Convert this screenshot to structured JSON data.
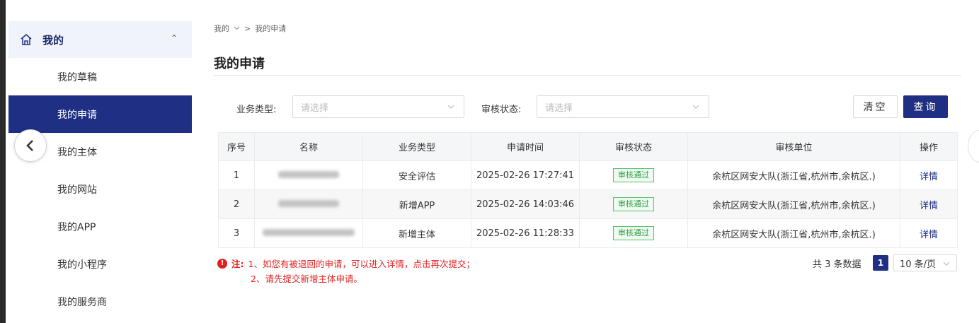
{
  "sidebar": {
    "header": "我的",
    "items": [
      {
        "label": "我的草稿"
      },
      {
        "label": "我的申请"
      },
      {
        "label": "我的主体"
      },
      {
        "label": "我的网站"
      },
      {
        "label": "我的APP"
      },
      {
        "label": "我的小程序"
      },
      {
        "label": "我的服务商"
      }
    ],
    "active_index": 1
  },
  "breadcrumb": {
    "root": "我的",
    "current": "我的申请"
  },
  "page_title": "我的申请",
  "filters": {
    "business_type_label": "业务类型:",
    "business_type_placeholder": "请选择",
    "review_status_label": "审核状态:",
    "review_status_placeholder": "请选择",
    "clear_label": "清空",
    "query_label": "查询"
  },
  "table": {
    "columns": [
      "序号",
      "名称",
      "业务类型",
      "申请时间",
      "审核状态",
      "审核单位",
      "操作"
    ],
    "rows": [
      {
        "index": "1",
        "name": "",
        "type": "安全评估",
        "time": "2025-02-26 17:27:41",
        "status": "审核通过",
        "unit": "余杭区网安大队(浙江省,杭州市,余杭区.)",
        "action": "详情"
      },
      {
        "index": "2",
        "name": "",
        "type": "新增APP",
        "time": "2025-02-26 14:03:46",
        "status": "审核通过",
        "unit": "余杭区网安大队(浙江省,杭州市,余杭区.)",
        "action": "详情"
      },
      {
        "index": "3",
        "name": "",
        "type": "新增主体",
        "time": "2025-02-26 11:28:33",
        "status": "审核通过",
        "unit": "余杭区网安大队(浙江省,杭州市,余杭区.)",
        "action": "详情"
      }
    ]
  },
  "notes": {
    "prefix": "注:",
    "line1": "1、如您有被退回的申请，可以进入详情，点击再次提交；",
    "line2": "2、请先提交新增主体申请。"
  },
  "pagination": {
    "total_text": "共 3 条数据",
    "current_page": "1",
    "page_size": "10 条/页"
  },
  "colors": {
    "primary": "#1e2f84",
    "success": "#2f9e44",
    "warning": "#e02020"
  }
}
